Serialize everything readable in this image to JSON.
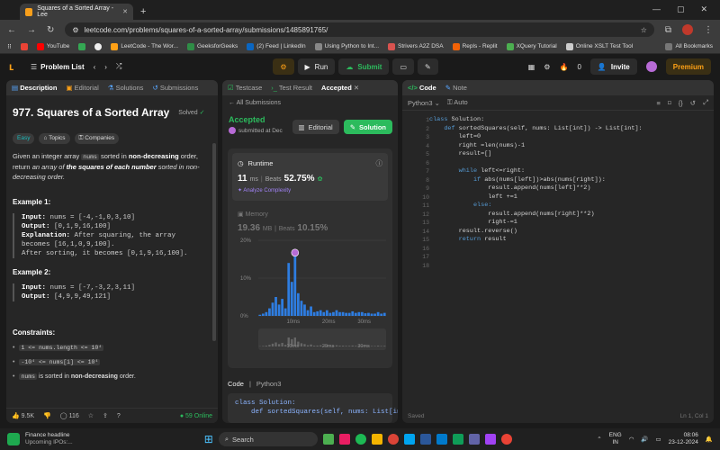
{
  "browser": {
    "tab_title": "Squares of a Sorted Array - Lee",
    "url": "leetcode.com/problems/squares-of-a-sorted-array/submissions/1485891765/",
    "bookmarks": [
      "YouTube",
      "LeetCode - The Wor...",
      "GeeksforGeeks",
      "(2) Feed | LinkedIn",
      "Using Python to Int...",
      "Strivers A2Z DSA",
      "Repls - Replit",
      "XQuery Tutorial",
      "Online XSLT Test Tool",
      "All Bookmarks"
    ]
  },
  "nav": {
    "problem_list": "Problem List",
    "run": "Run",
    "submit": "Submit",
    "fire_count": "0",
    "invite": "Invite",
    "premium": "Premium"
  },
  "left": {
    "tabs": [
      "Description",
      "Editorial",
      "Solutions",
      "Submissions"
    ],
    "title": "977. Squares of a Sorted Array",
    "solved": "Solved",
    "tags": [
      "Easy",
      "Topics",
      "Companies"
    ],
    "desc1a": "Given an integer array ",
    "desc1code": "nums",
    "desc1b": " sorted in ",
    "desc1bold": "non-decreasing",
    "desc1c": " order, return ",
    "desc1ital": "an array of ",
    "desc1bold2": "the squares of each number",
    "desc1d": " sorted in non-decreasing order.",
    "ex1_title": "Example 1:",
    "ex1_input_label": "Input:",
    "ex1_input": " nums = [-4,-1,0,3,10]",
    "ex1_output_label": "Output:",
    "ex1_output": " [0,1,9,16,100]",
    "ex1_expl_label": "Explanation:",
    "ex1_expl1": " After squaring, the array",
    "ex1_expl2": "becomes [16,1,0,9,100].",
    "ex1_expl3": "After sorting, it becomes [0,1,9,16,100].",
    "ex2_title": "Example 2:",
    "ex2_input_label": "Input:",
    "ex2_input": " nums = [-7,-3,2,3,11]",
    "ex2_output_label": "Output:",
    "ex2_output": " [4,9,9,49,121]",
    "constraints_title": "Constraints:",
    "c1": "1 <= nums.length <= 10⁴",
    "c2": "-10⁴ <= nums[i] <= 10⁴",
    "c3code": "nums",
    "c3a": " is sorted in ",
    "c3bold": "non-decreasing",
    "c3b": " order.",
    "likes": "9.5K",
    "comments": "116",
    "online": "59 Online"
  },
  "mid": {
    "tabs": [
      "Testcase",
      "Test Result",
      "Accepted"
    ],
    "all_submissions": "All Submissions",
    "status": "Accepted",
    "submitted": "submitted at Dec",
    "editorial": "Editorial",
    "solution": "Solution",
    "runtime_label": "Runtime",
    "runtime_value": "11",
    "runtime_unit": "ms",
    "beats_label": "Beats",
    "runtime_beats": "52.75%",
    "analyze": "Analyze Complexity",
    "memory_label": "Memory",
    "memory_value": "19.36",
    "memory_unit": "MB",
    "memory_beats": "10.15%",
    "code_label": "Code",
    "lang": "Python3",
    "preview1": "class Solution:",
    "preview2": "    def sortedSquares(self, nums: List[in"
  },
  "chart_data": {
    "type": "bar",
    "ylabel_ticks": [
      "0%",
      "10%",
      "20%"
    ],
    "ylim": [
      0,
      20
    ],
    "xticks": [
      "10ms",
      "20ms",
      "30ms"
    ],
    "values": [
      0.3,
      0.6,
      1,
      2,
      3.5,
      5,
      3,
      4.5,
      2,
      14,
      9,
      16,
      6,
      4,
      3,
      1.5,
      2.5,
      1,
      1.2,
      1.5,
      1,
      1.5,
      0.8,
      1,
      1.5,
      1,
      1,
      0.8,
      0.8,
      1.2,
      0.8,
      1,
      1,
      0.7,
      0.8,
      0.6,
      0.6,
      1,
      0.6,
      0.8
    ],
    "highlight_index": 11,
    "mini_xticks": [
      "10ms",
      "20ms",
      "30ms"
    ]
  },
  "right": {
    "tabs": [
      "Code",
      "Note"
    ],
    "lang": "Python3",
    "auto": "Auto",
    "lines": [
      "class Solution:",
      "    def sortedSquares(self, nums: List[int]) -> List[int]:",
      "        left=0",
      "        right =len(nums)-1",
      "        result=[]",
      "",
      "        while left<=right:",
      "            if abs(nums[left])>abs(nums[right]):",
      "                result.append(nums[left]**2)",
      "                left +=1",
      "            else:",
      "                result.append(nums[right]**2)",
      "                right-=1",
      "        result.reverse()",
      "        return result",
      "",
      "",
      ""
    ],
    "saved": "Saved",
    "position": "Ln 1, Col 1"
  },
  "taskbar": {
    "news_title": "Finance headline",
    "news_sub": "Upcoming IPOs:...",
    "search": "Search",
    "lang1": "ENG",
    "lang2": "IN",
    "time": "08:06",
    "date": "23-12-2024"
  }
}
